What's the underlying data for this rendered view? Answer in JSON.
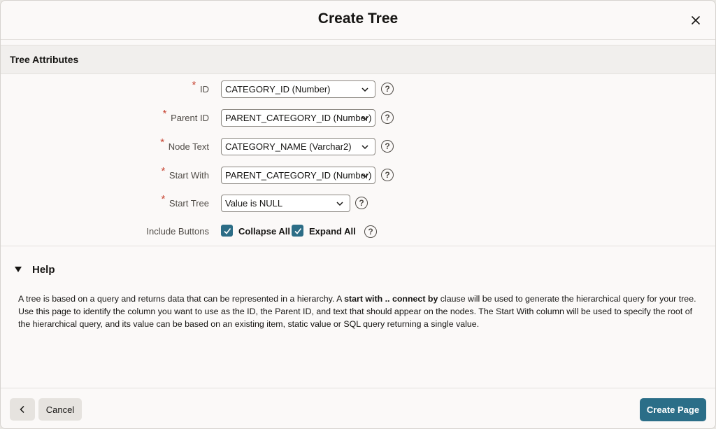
{
  "dialog": {
    "title": "Create Tree",
    "close_icon": "close-icon"
  },
  "section": {
    "title": "Tree Attributes"
  },
  "fields": {
    "id": {
      "label": "ID",
      "required": "*",
      "value": "CATEGORY_ID (Number)"
    },
    "parent_id": {
      "label": "Parent ID",
      "required": "*",
      "value": "PARENT_CATEGORY_ID (Number)"
    },
    "node_text": {
      "label": "Node Text",
      "required": "*",
      "value": "CATEGORY_NAME (Varchar2)"
    },
    "start_with": {
      "label": "Start With",
      "required": "*",
      "value": "PARENT_CATEGORY_ID (Number)"
    },
    "start_tree": {
      "label": "Start Tree",
      "required": "*",
      "value": "Value is NULL"
    },
    "include_buttons": {
      "label": "Include Buttons",
      "collapse_all": "Collapse All",
      "expand_all": "Expand All"
    }
  },
  "help": {
    "heading": "Help",
    "text_1": "A tree is based on a query and returns data that can be represented in a hierarchy. A ",
    "text_bold": "start with .. connect by",
    "text_2": " clause will be used to generate the hierarchical query for your tree. Use this page to identify the column you want to use as the ID, the Parent ID, and text that should appear on the nodes. The Start With column will be used to specify the root of the hierarchical query, and its value can be based on an existing item, static value or SQL query returning a single value."
  },
  "footer": {
    "back_icon": "chevron-left-icon",
    "cancel_label": "Cancel",
    "create_label": "Create Page"
  },
  "colors": {
    "accent": "#2b6e88",
    "checkbox": "#2c6d86",
    "required": "#c74634",
    "background": "#fbf9f8"
  }
}
